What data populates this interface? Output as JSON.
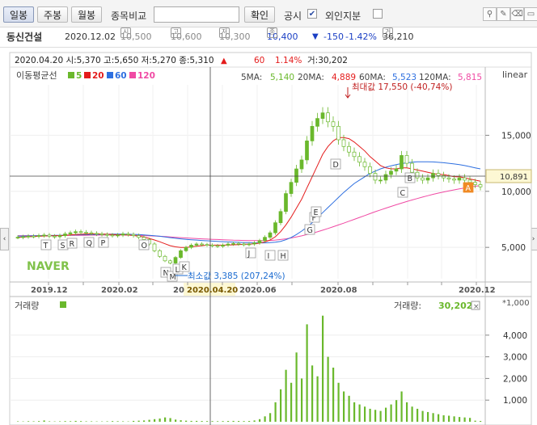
{
  "toolbar": {
    "daily": "일봉",
    "weekly": "주봉",
    "monthly": "월봉",
    "compare_label": "종목비교",
    "compare_placeholder": "",
    "confirm": "확인",
    "disclosure": "공시",
    "disclosure_checked": "✔",
    "foreign": "외인지분",
    "tool_icons": [
      "pin-icon",
      "pencil-icon",
      "eraser-icon",
      "ruler-icon"
    ]
  },
  "info": {
    "name": "동신건설",
    "date": "2020.12.02",
    "open_icon": "시",
    "open": "10,500",
    "high_icon": "고",
    "high": "10,600",
    "low_icon": "저",
    "low": "10,300",
    "close_icon": "종",
    "close": "10,400",
    "change_arrow": "▼",
    "change": "-150",
    "change_pct": "-1.42%",
    "volume_icon": "거",
    "volume": "36,210"
  },
  "hover": {
    "text": "2020.04.20 시:5,370 고:5,650 저:5,270 종:5,310",
    "arrow": "▲",
    "delta": "60",
    "delta_pct": "1.14%",
    "volume": "거:30,202"
  },
  "legend": {
    "label": "이동평균선",
    "items": [
      {
        "text": "5",
        "color": "#6ab82c"
      },
      {
        "text": "20",
        "color": "#e41c1c"
      },
      {
        "text": "60",
        "color": "#2d6fe0"
      },
      {
        "text": "120",
        "color": "#f04aa4"
      }
    ],
    "scale": "linear"
  },
  "ma_values": {
    "ma5_label": "5MA:",
    "ma5": "5,140",
    "ma20_label": "20MA:",
    "ma20": "4,889",
    "ma60_label": "60MA:",
    "ma60": "5,523",
    "ma120_label": "120MA:",
    "ma120": "5,815"
  },
  "annotations": {
    "max": "최대값 17,550 (-40,74%)",
    "min": "최소값 3,385 (207,24%)"
  },
  "watermark": "NAVER",
  "cursor_price": "10,891",
  "cursor_date": "2020.04.20",
  "volume_panel": {
    "label": "거래량",
    "right_label": "거래량:",
    "right_value": "30,202",
    "unit": "*1,000",
    "close_x": "×"
  },
  "colors": {
    "ma5": "#6ab82c",
    "ma20": "#e41c1c",
    "ma60": "#2d6fe0",
    "ma120": "#f04aa4",
    "up": "#6ab82c",
    "down": "#6ab82c",
    "volume": "#6ab82c"
  },
  "chart_data": [
    {
      "type": "candlestick",
      "title": "동신건설",
      "y_scale": "linear",
      "xlim": [
        "2019.11",
        "2020.12.02"
      ],
      "ylim": [
        2200,
        19500
      ],
      "x_tick_labels": [
        "2019.12",
        "2020.02",
        "20",
        "2020.06",
        "2020.08",
        "2020.10",
        "2020.12"
      ],
      "y_tick_labels": [
        "15,000",
        "10,000",
        "5,000"
      ],
      "y_ticks": [
        15000,
        10000,
        5000
      ],
      "close_series": [
        5900,
        5950,
        6000,
        5980,
        6050,
        6100,
        6000,
        5950,
        6050,
        6200,
        6300,
        6400,
        6350,
        6300,
        6250,
        6200,
        6150,
        6100,
        6050,
        6100,
        6200,
        6150,
        6050,
        5900,
        5700,
        5300,
        4700,
        4200,
        3800,
        3600,
        4100,
        4700,
        5000,
        5200,
        5300,
        5250,
        5200,
        5150,
        5100,
        5200,
        5300,
        5350,
        5300,
        5250,
        5300,
        5400,
        5600,
        5900,
        6300,
        7200,
        8200,
        9800,
        10800,
        12000,
        12800,
        14500,
        15800,
        16500,
        17000,
        16200,
        15800,
        14600,
        14000,
        13500,
        13100,
        12600,
        12200,
        11600,
        11000,
        11000,
        11500,
        11800,
        12000,
        13200,
        12500,
        11700,
        11200,
        11000,
        11200,
        11600,
        11400,
        11200,
        11100,
        11000,
        11200,
        11000,
        10800,
        10600,
        10400
      ],
      "ma20": [
        5900,
        5920,
        5950,
        5970,
        5990,
        6010,
        6030,
        6040,
        6060,
        6080,
        6110,
        6140,
        6170,
        6190,
        6200,
        6200,
        6190,
        6170,
        6150,
        6130,
        6120,
        6100,
        6060,
        6000,
        5920,
        5800,
        5660,
        5500,
        5320,
        5150,
        5050,
        5000,
        5000,
        5050,
        5100,
        5150,
        5200,
        5200,
        5200,
        5200,
        5210,
        5230,
        5250,
        5270,
        5290,
        5320,
        5380,
        5480,
        5650,
        5950,
        6400,
        7000,
        7700,
        8500,
        9300,
        10300,
        11300,
        12300,
        13300,
        14000,
        14500,
        14800,
        14800,
        14700,
        14400,
        14000,
        13600,
        13100,
        12700,
        12300,
        12100,
        12000,
        12000,
        12100,
        12100,
        12000,
        11900,
        11800,
        11700,
        11600,
        11500,
        11500,
        11400,
        11300,
        11300,
        11200,
        11100,
        11000,
        10900
      ],
      "ma60": [
        6000,
        6010,
        6020,
        6030,
        6040,
        6050,
        6060,
        6070,
        6080,
        6090,
        6100,
        6110,
        6120,
        6130,
        6140,
        6150,
        6160,
        6170,
        6180,
        6180,
        6180,
        6170,
        6160,
        6140,
        6110,
        6080,
        6040,
        5990,
        5930,
        5870,
        5810,
        5760,
        5720,
        5680,
        5650,
        5620,
        5590,
        5560,
        5530,
        5510,
        5490,
        5470,
        5450,
        5430,
        5420,
        5410,
        5400,
        5400,
        5420,
        5460,
        5540,
        5680,
        5880,
        6140,
        6450,
        6800,
        7200,
        7650,
        8100,
        8550,
        9000,
        9450,
        9900,
        10300,
        10700,
        11000,
        11300,
        11600,
        11800,
        12000,
        12150,
        12280,
        12380,
        12480,
        12540,
        12600,
        12630,
        12640,
        12640,
        12620,
        12590,
        12550,
        12500,
        12440,
        12380,
        12300,
        12200,
        12100,
        12000
      ],
      "ma120": [
        6050,
        6050,
        6050,
        6050,
        6050,
        6050,
        6050,
        6050,
        6060,
        6060,
        6070,
        6070,
        6080,
        6080,
        6090,
        6090,
        6100,
        6100,
        6100,
        6100,
        6100,
        6090,
        6080,
        6070,
        6050,
        6030,
        6010,
        5990,
        5960,
        5930,
        5900,
        5870,
        5840,
        5810,
        5780,
        5760,
        5740,
        5720,
        5700,
        5680,
        5660,
        5640,
        5630,
        5620,
        5610,
        5600,
        5600,
        5600,
        5620,
        5650,
        5700,
        5760,
        5840,
        5930,
        6030,
        6140,
        6260,
        6390,
        6530,
        6680,
        6840,
        7000,
        7160,
        7330,
        7500,
        7670,
        7840,
        8010,
        8180,
        8340,
        8500,
        8650,
        8800,
        8950,
        9090,
        9230,
        9360,
        9490,
        9610,
        9730,
        9840,
        9940,
        10040,
        10130,
        10220,
        10300,
        10380,
        10450,
        10510
      ],
      "event_markers": [
        {
          "label": "T",
          "color": "#666"
        },
        {
          "label": "S",
          "color": "#666"
        },
        {
          "label": "R",
          "color": "#666"
        },
        {
          "label": "Q",
          "color": "#666"
        },
        {
          "label": "P",
          "color": "#666"
        },
        {
          "label": "O",
          "color": "#666"
        },
        {
          "label": "N",
          "color": "#666"
        },
        {
          "label": "M",
          "color": "#666"
        },
        {
          "label": "L",
          "color": "#666"
        },
        {
          "label": "K",
          "color": "#666"
        },
        {
          "label": "J",
          "color": "#666"
        },
        {
          "label": "I",
          "color": "#666"
        },
        {
          "label": "H",
          "color": "#666"
        },
        {
          "label": "G",
          "color": "#666"
        },
        {
          "label": "F",
          "color": "#666"
        },
        {
          "label": "E",
          "color": "#666"
        },
        {
          "label": "D",
          "color": "#666"
        },
        {
          "label": "C",
          "color": "#666"
        },
        {
          "label": "B",
          "color": "#666"
        },
        {
          "label": "A",
          "color": "#f08a24"
        }
      ],
      "annotations": [
        "최대값 17,550 (-40,74%)",
        "최소값 3,385 (207,24%)"
      ],
      "grid": true,
      "legend": "top-left"
    },
    {
      "type": "bar",
      "title": "거래량",
      "unit": "*1,000",
      "ylim": [
        0,
        5000
      ],
      "y_tick_labels": [
        "4,000",
        "3,000",
        "2,000",
        "1,000"
      ],
      "y_ticks": [
        4000,
        3000,
        2000,
        1000
      ],
      "values": [
        20,
        15,
        25,
        20,
        30,
        60,
        20,
        15,
        20,
        30,
        25,
        40,
        30,
        20,
        20,
        15,
        15,
        20,
        30,
        25,
        20,
        15,
        40,
        50,
        60,
        90,
        120,
        150,
        200,
        170,
        100,
        70,
        50,
        40,
        40,
        35,
        30,
        30,
        25,
        30,
        35,
        40,
        35,
        30,
        35,
        60,
        120,
        250,
        400,
        900,
        1500,
        2400,
        1800,
        3200,
        2000,
        4500,
        2600,
        2100,
        4900,
        3000,
        2500,
        1800,
        1400,
        1200,
        900,
        800,
        700,
        600,
        550,
        500,
        650,
        800,
        1000,
        1400,
        900,
        700,
        600,
        500,
        450,
        400,
        350,
        300,
        280,
        250,
        220,
        200,
        180,
        50,
        36
      ],
      "grid": true
    }
  ]
}
